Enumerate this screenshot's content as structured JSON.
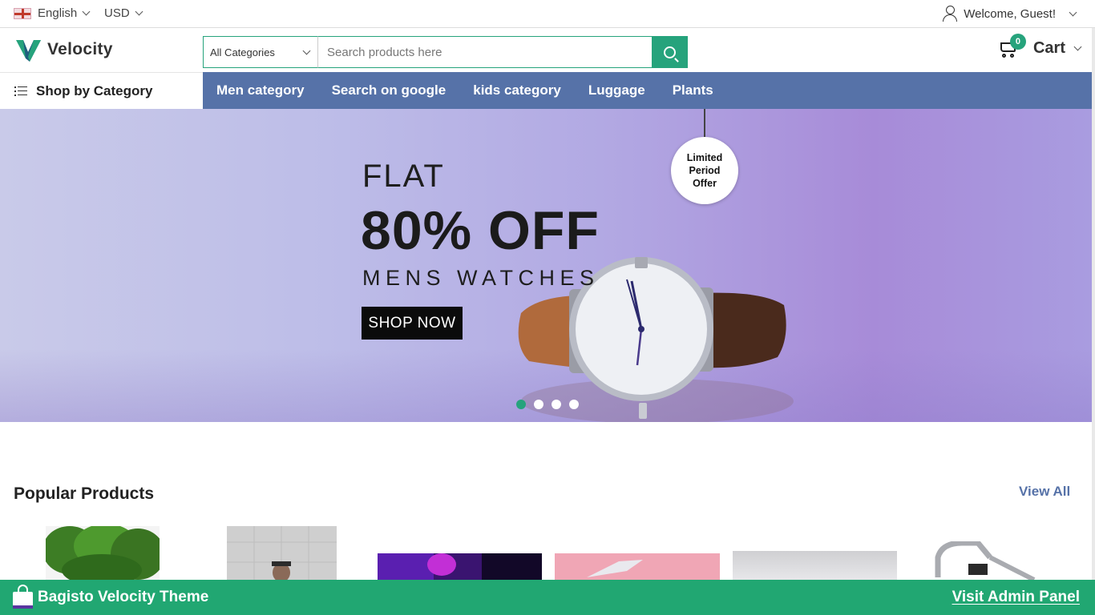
{
  "topbar": {
    "language": "English",
    "currency": "USD",
    "welcome": "Welcome, Guest!"
  },
  "header": {
    "logo_text": "Velocity",
    "search": {
      "category": "All Categories",
      "placeholder": "Search products here"
    },
    "cart": {
      "count": "0",
      "label": "Cart"
    }
  },
  "nav": {
    "shop_by_category": "Shop by Category",
    "items": [
      "Men category",
      "Search on google",
      "kids category",
      "Luggage",
      "Plants"
    ]
  },
  "hero": {
    "flat": "FLAT",
    "discount": "80% OFF",
    "subtitle": "MENS WATCHES",
    "button": "SHOP NOW",
    "tag": "Limited Period Offer",
    "slides": 4,
    "active_slide": 1
  },
  "popular": {
    "title": "Popular Products",
    "view_all": "View All"
  },
  "footer_bar": {
    "title": "Bagisto Velocity Theme",
    "link": "Visit Admin Panel"
  },
  "colors": {
    "accent": "#26a37c",
    "nav": "#5672a8",
    "footer": "#21a772"
  }
}
